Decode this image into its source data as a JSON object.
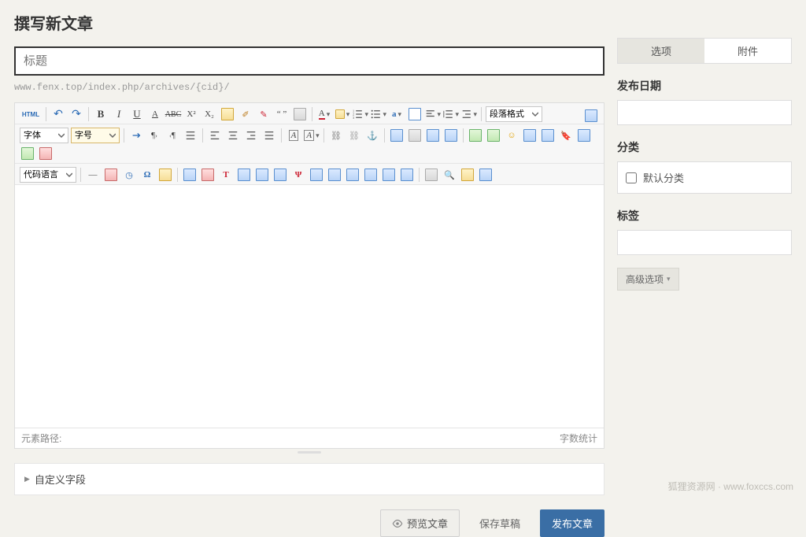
{
  "page_title": "撰写新文章",
  "title_placeholder": "标题",
  "permalink": "www.fenx.top/index.php/archives/{cid}/",
  "toolbar": {
    "html": "HTML",
    "paragraph_format": "段落格式",
    "font_family": "字体",
    "font_size": "字号",
    "code_lang": "代码语言",
    "letters": {
      "b": "B",
      "i": "I",
      "u": "U",
      "s": "ABC",
      "x2": "X²",
      "x2b": "X₂",
      "a_font": "A",
      "a_color": "A",
      "quote": "“ ”",
      "aa": "Aa"
    }
  },
  "editor_footer": {
    "path": "元素路径:",
    "wordcount": "字数统计"
  },
  "custom_fields": "自定义字段",
  "actions": {
    "preview": "预览文章",
    "draft": "保存草稿",
    "publish": "发布文章"
  },
  "sidebar": {
    "tabs": {
      "options": "选项",
      "attachments": "附件"
    },
    "publish_date": "发布日期",
    "category": "分类",
    "default_category": "默认分类",
    "tags": "标签",
    "advanced": "高级选项"
  },
  "watermark": "狐狸资源网 · www.foxccs.com"
}
